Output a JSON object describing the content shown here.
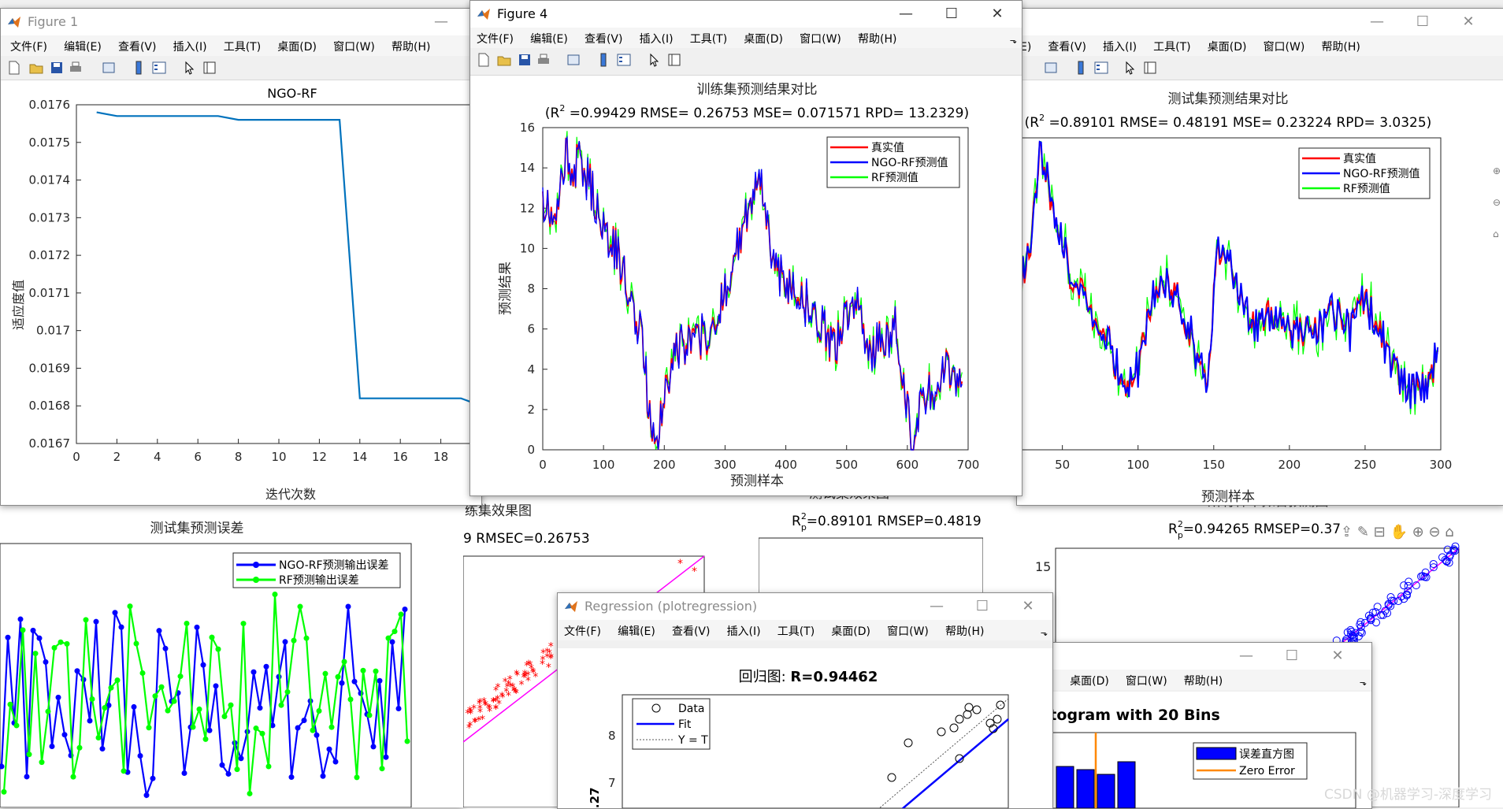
{
  "menu": {
    "file": "文件(F)",
    "edit": "编辑(E)",
    "view": "查看(V)",
    "insert": "插入(I)",
    "tools": "工具(T)",
    "desktop": "桌面(D)",
    "window": "窗口(W)",
    "help": "帮助(H)"
  },
  "menu_partial_edit": "E)",
  "menu_partial_tools": "T)",
  "colors": {
    "real": "#ff0000",
    "pred": "#0000ff",
    "rf": "#00ff00",
    "curve": "#0072bd",
    "fit_line": "#ff00ff",
    "zero_err": "#ff8800"
  },
  "fig1": {
    "title": "Figure 1",
    "chart_data": {
      "type": "line",
      "title": "NGO-RF",
      "xlabel": "迭代次数",
      "ylabel": "适应度值",
      "xlim": [
        0,
        20
      ],
      "ylim": [
        0.0167,
        0.0176
      ],
      "xticks": [
        "0",
        "2",
        "4",
        "6",
        "8",
        "10",
        "12",
        "14",
        "16",
        "18"
      ],
      "yticks": [
        "0.0167",
        "0.0168",
        "0.0169",
        "0.017",
        "0.0171",
        "0.0172",
        "0.0173",
        "0.0174",
        "0.0175",
        "0.0176"
      ],
      "x": [
        1,
        2,
        3,
        4,
        5,
        6,
        7,
        8,
        9,
        10,
        11,
        12,
        13,
        14,
        15,
        16,
        17,
        18,
        19,
        20
      ],
      "y": [
        0.01758,
        0.01757,
        0.01757,
        0.01757,
        0.01757,
        0.01757,
        0.01757,
        0.01756,
        0.01756,
        0.01756,
        0.01756,
        0.01756,
        0.01756,
        0.01682,
        0.01682,
        0.01682,
        0.01682,
        0.01682,
        0.01682,
        0.0168
      ]
    }
  },
  "fig4": {
    "title": "Figure 4",
    "chart_data": {
      "type": "line",
      "title": "训练集预测结果对比",
      "subtitle_lead": "(R",
      "subtitle_sup": "2",
      "subtitle_rest": " =0.99429 RMSE= 0.26753 MSE= 0.071571 RPD= 13.2329)",
      "xlabel": "预测样本",
      "ylabel": "预测结果",
      "xlim": [
        0,
        700
      ],
      "ylim": [
        0,
        16
      ],
      "xticks": [
        "0",
        "100",
        "200",
        "300",
        "400",
        "500",
        "600",
        "700"
      ],
      "yticks": [
        "0",
        "2",
        "4",
        "6",
        "8",
        "10",
        "12",
        "14",
        "16"
      ],
      "legend": [
        "真实值",
        "NGO-RF预测值",
        "RF预测值"
      ],
      "legend_position": "top-right",
      "x": [
        0,
        20,
        40,
        50,
        60,
        80,
        100,
        120,
        140,
        160,
        175,
        190,
        200,
        220,
        240,
        260,
        280,
        300,
        320,
        340,
        360,
        370,
        380,
        400,
        420,
        440,
        460,
        480,
        500,
        520,
        540,
        560,
        580,
        600,
        610,
        620,
        640,
        660,
        680,
        690
      ],
      "y": [
        12.5,
        11,
        15,
        13.5,
        14.5,
        13,
        11,
        10,
        8,
        6,
        2,
        0.5,
        3,
        5,
        5.2,
        5.5,
        6,
        8,
        10,
        12,
        13.5,
        11,
        9.5,
        8,
        8,
        7,
        6,
        5,
        6.5,
        7,
        5,
        5.5,
        6,
        2,
        0.5,
        2,
        3,
        4,
        3.5,
        3.8
      ]
    }
  },
  "fig3": {
    "chart_data": {
      "type": "line",
      "title": "测试集预测结果对比",
      "subtitle_lead": "(R",
      "subtitle_sup": "2",
      "subtitle_rest": " =0.89101 RMSE= 0.48191 MSE= 0.23224 RPD= 3.0325)",
      "xlabel": "预测样本",
      "xlim": [
        20,
        300
      ],
      "xticks": [
        "50",
        "100",
        "150",
        "200",
        "250",
        "300"
      ],
      "legend": [
        "真实值",
        "NGO-RF预测值",
        "RF预测值"
      ],
      "legend_position": "top-right",
      "x": [
        20,
        28,
        35,
        45,
        55,
        70,
        80,
        90,
        100,
        110,
        118,
        125,
        135,
        145,
        152,
        160,
        170,
        180,
        190,
        200,
        210,
        220,
        230,
        240,
        250,
        260,
        270,
        280,
        290,
        300
      ],
      "y": [
        8,
        10,
        15.5,
        12,
        9,
        7,
        6,
        3,
        4,
        8,
        8.5,
        8,
        6,
        3,
        10,
        10.5,
        7,
        6.5,
        7,
        6.5,
        6,
        6.2,
        7,
        6,
        8,
        6,
        4,
        3,
        3.5,
        5
      ]
    }
  },
  "fig_err": {
    "chart_data": {
      "type": "line",
      "title": "测试集预测误差",
      "legend": [
        "NGO-RF预测输出误差",
        "RF预测输出误差"
      ],
      "legend_position": "top-right"
    }
  },
  "fig_train_eff": {
    "title_partial": "练集效果图",
    "stats_partial": "9  RMSEC=0.26753"
  },
  "fig_test_eff": {
    "title_partial": "测试集效果图",
    "stats_lead": "R",
    "stats_sup": "2",
    "stats_sub": "p",
    "stats_rest": "=0.89101  RMSEP=0.4819"
  },
  "fig_all": {
    "title_partial": "所有样本拟合预测图",
    "stats_lead": "R",
    "stats_sup": "2",
    "stats_sub": "p",
    "stats_rest": "=0.94265  RMSEP=0.37",
    "ytick_15": "15"
  },
  "fig_reg": {
    "title": "Regression (plotregression)",
    "plot_title_prefix": "回归图: ",
    "plot_title_value": "R=0.94462",
    "legend": [
      "Data",
      "Fit",
      "Y = T"
    ],
    "yticks": [
      "7",
      "8"
    ],
    "ylabel_partial": "0.27"
  },
  "fig_hist": {
    "title_partial": "stogram with 20 Bins",
    "legend": [
      "误差直方图",
      "Zero Error"
    ],
    "menu_partial": ")"
  },
  "watermark": "CSDN @机器学习-深度学习"
}
